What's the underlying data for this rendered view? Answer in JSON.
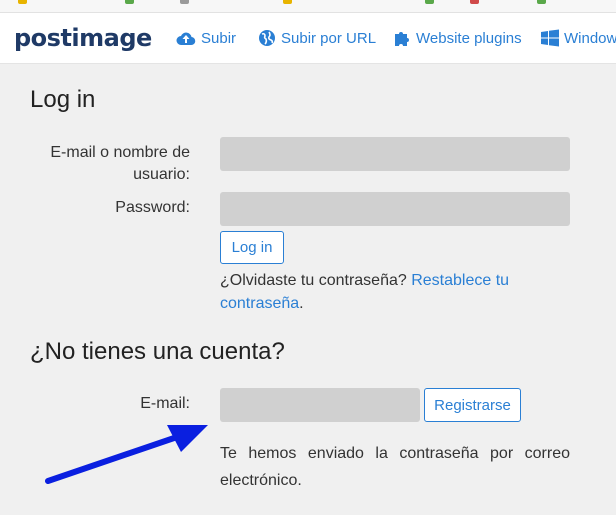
{
  "nav": {
    "logo_text": "postimage",
    "items": [
      {
        "label": "Subir",
        "icon": "cloud-upload-icon"
      },
      {
        "label": "Subir por URL",
        "icon": "globe-icon"
      },
      {
        "label": "Website plugins",
        "icon": "puzzle-icon"
      },
      {
        "label": "Windows",
        "icon": "windows-icon"
      }
    ]
  },
  "login": {
    "title": "Log in",
    "user_label": "E-mail o nombre de usuario:",
    "password_label": "Password:",
    "button": "Log in",
    "forgot_text": "¿Olvidaste tu contraseña?",
    "reset_link": "Restablece tu contraseña",
    "forgot_suffix": "."
  },
  "register": {
    "title": "¿No tienes una cuenta?",
    "email_label": "E-mail:",
    "button": "Registrarse",
    "message": "Te hemos enviado la contraseña por correo electrónico."
  },
  "colors": {
    "accent": "#2a7fd4",
    "annotation_arrow": "#0a1fe0",
    "input_bg": "#d0d0d0",
    "page_bg": "#f0f0f0"
  }
}
